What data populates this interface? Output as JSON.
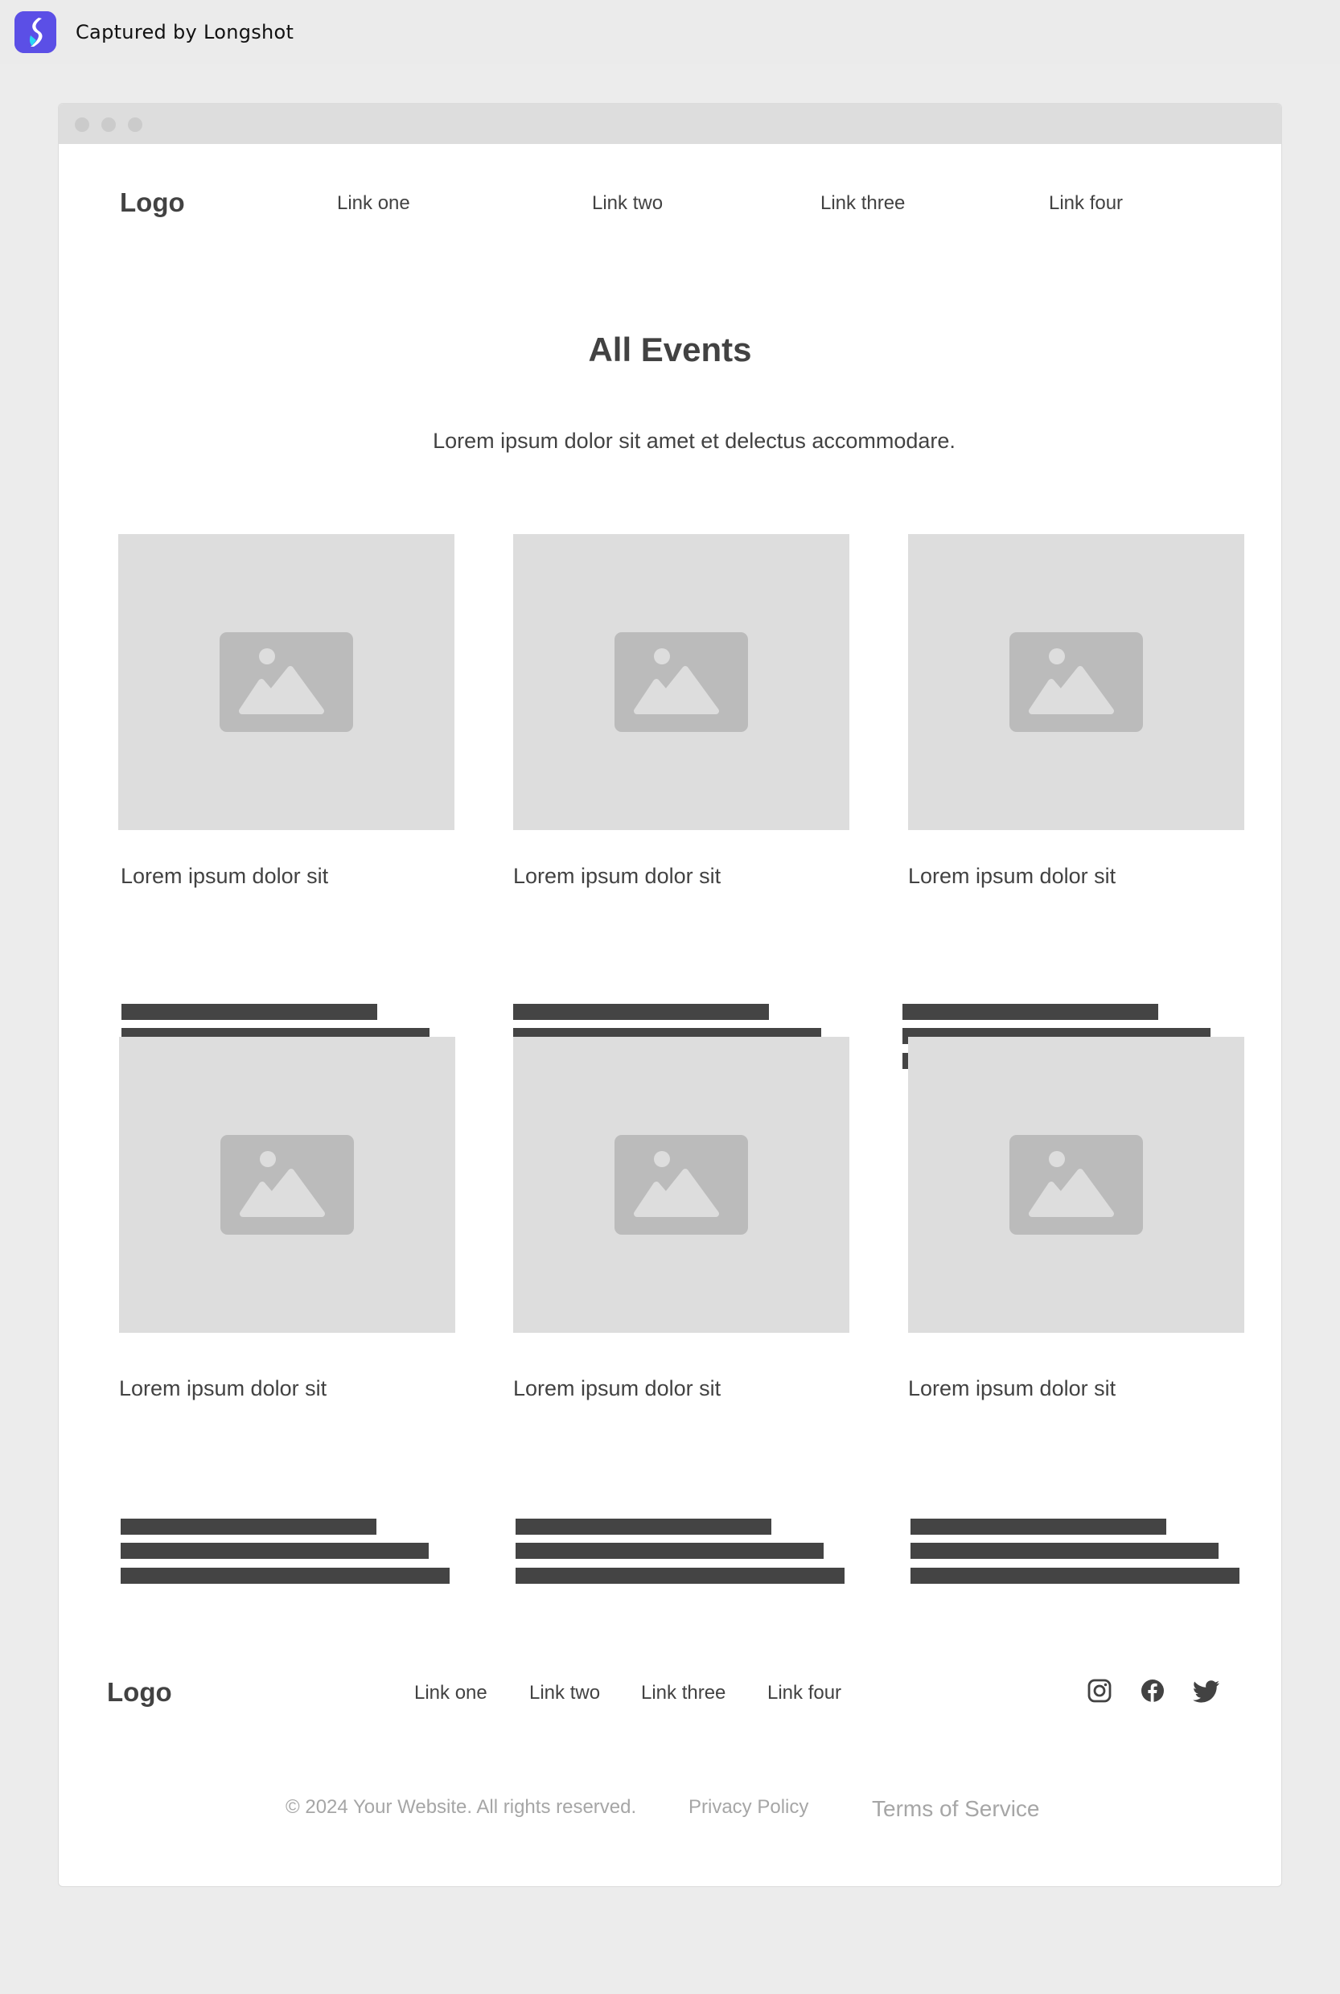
{
  "capture_bar": {
    "title": "Captured by Longshot",
    "icon": "longshot-app-icon"
  },
  "nav": {
    "logo": "Logo",
    "links": [
      "Link one",
      "Link two",
      "Link three",
      "Link four"
    ]
  },
  "hero": {
    "title": "All Events",
    "subtitle": "Lorem ipsum dolor sit amet et delectus accommodare."
  },
  "events": [
    {
      "title": "Lorem ipsum dolor sit",
      "image_icon": "image-placeholder-icon"
    },
    {
      "title": "Lorem ipsum dolor sit",
      "image_icon": "image-placeholder-icon"
    },
    {
      "title": "Lorem ipsum dolor sit",
      "image_icon": "image-placeholder-icon"
    },
    {
      "title": "Lorem ipsum dolor sit",
      "image_icon": "image-placeholder-icon"
    },
    {
      "title": "Lorem ipsum dolor sit",
      "image_icon": "image-placeholder-icon"
    },
    {
      "title": "Lorem ipsum dolor sit",
      "image_icon": "image-placeholder-icon"
    }
  ],
  "footer": {
    "logo": "Logo",
    "links": [
      "Link one",
      "Link two",
      "Link three",
      "Link four"
    ],
    "social_icons": [
      "instagram-icon",
      "facebook-icon",
      "twitter-icon"
    ],
    "copyright": "© 2024 Your Website. All rights reserved.",
    "privacy": "Privacy Policy",
    "terms": "Terms of Service"
  },
  "colors": {
    "page_background": "#ececec",
    "text": "#424242",
    "placeholder": "#dddddd",
    "placeholder_icon": "#bbbbbb",
    "muted_text": "#a6a6a6",
    "app_icon": "#5b4fe6"
  }
}
